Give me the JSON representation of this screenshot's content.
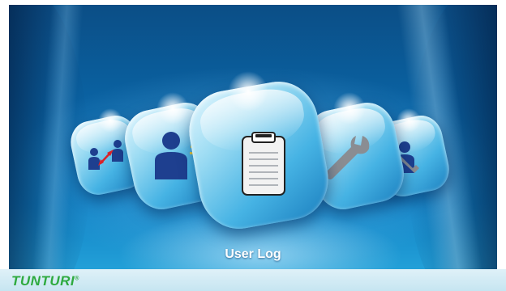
{
  "carousel": {
    "items": [
      {
        "id": "user-switch",
        "icon": "user-switch-icon"
      },
      {
        "id": "user-profile",
        "icon": "user-icon"
      },
      {
        "id": "user-log",
        "icon": "clipboard-icon"
      },
      {
        "id": "settings",
        "icon": "wrench-icon"
      },
      {
        "id": "service",
        "icon": "user-service-icon"
      }
    ],
    "selected_label": "User Log"
  },
  "footer": {
    "brand": "TUNTURI",
    "brand_mark": "®"
  },
  "colors": {
    "brand_green": "#2eaa3f",
    "background_blue": "#0a64a5",
    "icon_blue": "#1e3f8f"
  }
}
